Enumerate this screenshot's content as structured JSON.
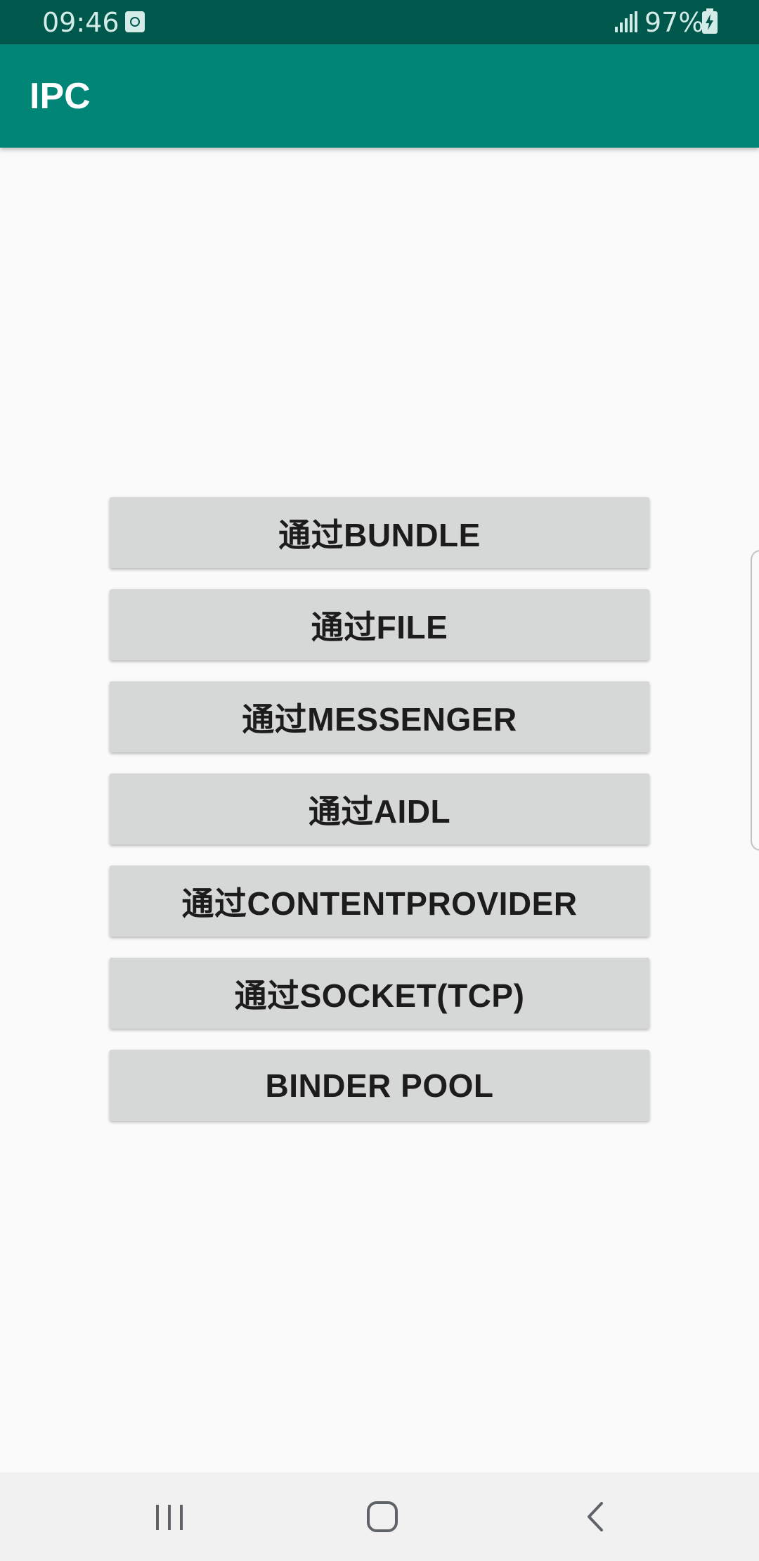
{
  "status_bar": {
    "time": "09:46",
    "battery_text": "97%",
    "icons": [
      "app-notification-icon",
      "signal-icon",
      "battery-charging-icon"
    ]
  },
  "app_bar": {
    "title": "IPC",
    "color": "#008577"
  },
  "buttons": [
    {
      "label": "通过BUNDLE"
    },
    {
      "label": "通过FILE"
    },
    {
      "label": "通过MESSENGER"
    },
    {
      "label": "通过AIDL"
    },
    {
      "label": "通过CONTENTPROVIDER"
    },
    {
      "label": "通过SOCKET(TCP)"
    },
    {
      "label": "BINDER POOL"
    }
  ],
  "nav_bar": {
    "icons": [
      "recents-icon",
      "home-icon",
      "back-icon"
    ]
  },
  "colors": {
    "status_bar": "#00574b",
    "app_bar": "#008577",
    "background": "#fafafa",
    "button": "#d6d7d7",
    "button_text": "#1c1c1c"
  }
}
